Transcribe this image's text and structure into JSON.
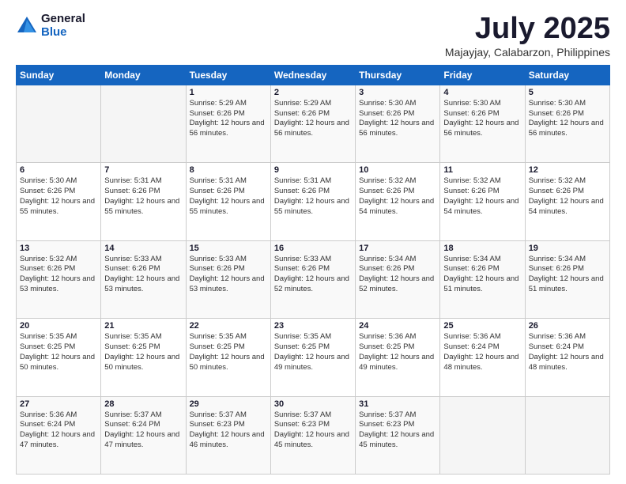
{
  "logo": {
    "general": "General",
    "blue": "Blue"
  },
  "title": "July 2025",
  "subtitle": "Majayjay, Calabarzon, Philippines",
  "headers": [
    "Sunday",
    "Monday",
    "Tuesday",
    "Wednesday",
    "Thursday",
    "Friday",
    "Saturday"
  ],
  "weeks": [
    [
      {
        "day": "",
        "sunrise": "",
        "sunset": "",
        "daylight": ""
      },
      {
        "day": "",
        "sunrise": "",
        "sunset": "",
        "daylight": ""
      },
      {
        "day": "1",
        "sunrise": "Sunrise: 5:29 AM",
        "sunset": "Sunset: 6:26 PM",
        "daylight": "Daylight: 12 hours and 56 minutes."
      },
      {
        "day": "2",
        "sunrise": "Sunrise: 5:29 AM",
        "sunset": "Sunset: 6:26 PM",
        "daylight": "Daylight: 12 hours and 56 minutes."
      },
      {
        "day": "3",
        "sunrise": "Sunrise: 5:30 AM",
        "sunset": "Sunset: 6:26 PM",
        "daylight": "Daylight: 12 hours and 56 minutes."
      },
      {
        "day": "4",
        "sunrise": "Sunrise: 5:30 AM",
        "sunset": "Sunset: 6:26 PM",
        "daylight": "Daylight: 12 hours and 56 minutes."
      },
      {
        "day": "5",
        "sunrise": "Sunrise: 5:30 AM",
        "sunset": "Sunset: 6:26 PM",
        "daylight": "Daylight: 12 hours and 56 minutes."
      }
    ],
    [
      {
        "day": "6",
        "sunrise": "Sunrise: 5:30 AM",
        "sunset": "Sunset: 6:26 PM",
        "daylight": "Daylight: 12 hours and 55 minutes."
      },
      {
        "day": "7",
        "sunrise": "Sunrise: 5:31 AM",
        "sunset": "Sunset: 6:26 PM",
        "daylight": "Daylight: 12 hours and 55 minutes."
      },
      {
        "day": "8",
        "sunrise": "Sunrise: 5:31 AM",
        "sunset": "Sunset: 6:26 PM",
        "daylight": "Daylight: 12 hours and 55 minutes."
      },
      {
        "day": "9",
        "sunrise": "Sunrise: 5:31 AM",
        "sunset": "Sunset: 6:26 PM",
        "daylight": "Daylight: 12 hours and 55 minutes."
      },
      {
        "day": "10",
        "sunrise": "Sunrise: 5:32 AM",
        "sunset": "Sunset: 6:26 PM",
        "daylight": "Daylight: 12 hours and 54 minutes."
      },
      {
        "day": "11",
        "sunrise": "Sunrise: 5:32 AM",
        "sunset": "Sunset: 6:26 PM",
        "daylight": "Daylight: 12 hours and 54 minutes."
      },
      {
        "day": "12",
        "sunrise": "Sunrise: 5:32 AM",
        "sunset": "Sunset: 6:26 PM",
        "daylight": "Daylight: 12 hours and 54 minutes."
      }
    ],
    [
      {
        "day": "13",
        "sunrise": "Sunrise: 5:32 AM",
        "sunset": "Sunset: 6:26 PM",
        "daylight": "Daylight: 12 hours and 53 minutes."
      },
      {
        "day": "14",
        "sunrise": "Sunrise: 5:33 AM",
        "sunset": "Sunset: 6:26 PM",
        "daylight": "Daylight: 12 hours and 53 minutes."
      },
      {
        "day": "15",
        "sunrise": "Sunrise: 5:33 AM",
        "sunset": "Sunset: 6:26 PM",
        "daylight": "Daylight: 12 hours and 53 minutes."
      },
      {
        "day": "16",
        "sunrise": "Sunrise: 5:33 AM",
        "sunset": "Sunset: 6:26 PM",
        "daylight": "Daylight: 12 hours and 52 minutes."
      },
      {
        "day": "17",
        "sunrise": "Sunrise: 5:34 AM",
        "sunset": "Sunset: 6:26 PM",
        "daylight": "Daylight: 12 hours and 52 minutes."
      },
      {
        "day": "18",
        "sunrise": "Sunrise: 5:34 AM",
        "sunset": "Sunset: 6:26 PM",
        "daylight": "Daylight: 12 hours and 51 minutes."
      },
      {
        "day": "19",
        "sunrise": "Sunrise: 5:34 AM",
        "sunset": "Sunset: 6:26 PM",
        "daylight": "Daylight: 12 hours and 51 minutes."
      }
    ],
    [
      {
        "day": "20",
        "sunrise": "Sunrise: 5:35 AM",
        "sunset": "Sunset: 6:25 PM",
        "daylight": "Daylight: 12 hours and 50 minutes."
      },
      {
        "day": "21",
        "sunrise": "Sunrise: 5:35 AM",
        "sunset": "Sunset: 6:25 PM",
        "daylight": "Daylight: 12 hours and 50 minutes."
      },
      {
        "day": "22",
        "sunrise": "Sunrise: 5:35 AM",
        "sunset": "Sunset: 6:25 PM",
        "daylight": "Daylight: 12 hours and 50 minutes."
      },
      {
        "day": "23",
        "sunrise": "Sunrise: 5:35 AM",
        "sunset": "Sunset: 6:25 PM",
        "daylight": "Daylight: 12 hours and 49 minutes."
      },
      {
        "day": "24",
        "sunrise": "Sunrise: 5:36 AM",
        "sunset": "Sunset: 6:25 PM",
        "daylight": "Daylight: 12 hours and 49 minutes."
      },
      {
        "day": "25",
        "sunrise": "Sunrise: 5:36 AM",
        "sunset": "Sunset: 6:24 PM",
        "daylight": "Daylight: 12 hours and 48 minutes."
      },
      {
        "day": "26",
        "sunrise": "Sunrise: 5:36 AM",
        "sunset": "Sunset: 6:24 PM",
        "daylight": "Daylight: 12 hours and 48 minutes."
      }
    ],
    [
      {
        "day": "27",
        "sunrise": "Sunrise: 5:36 AM",
        "sunset": "Sunset: 6:24 PM",
        "daylight": "Daylight: 12 hours and 47 minutes."
      },
      {
        "day": "28",
        "sunrise": "Sunrise: 5:37 AM",
        "sunset": "Sunset: 6:24 PM",
        "daylight": "Daylight: 12 hours and 47 minutes."
      },
      {
        "day": "29",
        "sunrise": "Sunrise: 5:37 AM",
        "sunset": "Sunset: 6:23 PM",
        "daylight": "Daylight: 12 hours and 46 minutes."
      },
      {
        "day": "30",
        "sunrise": "Sunrise: 5:37 AM",
        "sunset": "Sunset: 6:23 PM",
        "daylight": "Daylight: 12 hours and 45 minutes."
      },
      {
        "day": "31",
        "sunrise": "Sunrise: 5:37 AM",
        "sunset": "Sunset: 6:23 PM",
        "daylight": "Daylight: 12 hours and 45 minutes."
      },
      {
        "day": "",
        "sunrise": "",
        "sunset": "",
        "daylight": ""
      },
      {
        "day": "",
        "sunrise": "",
        "sunset": "",
        "daylight": ""
      }
    ]
  ]
}
